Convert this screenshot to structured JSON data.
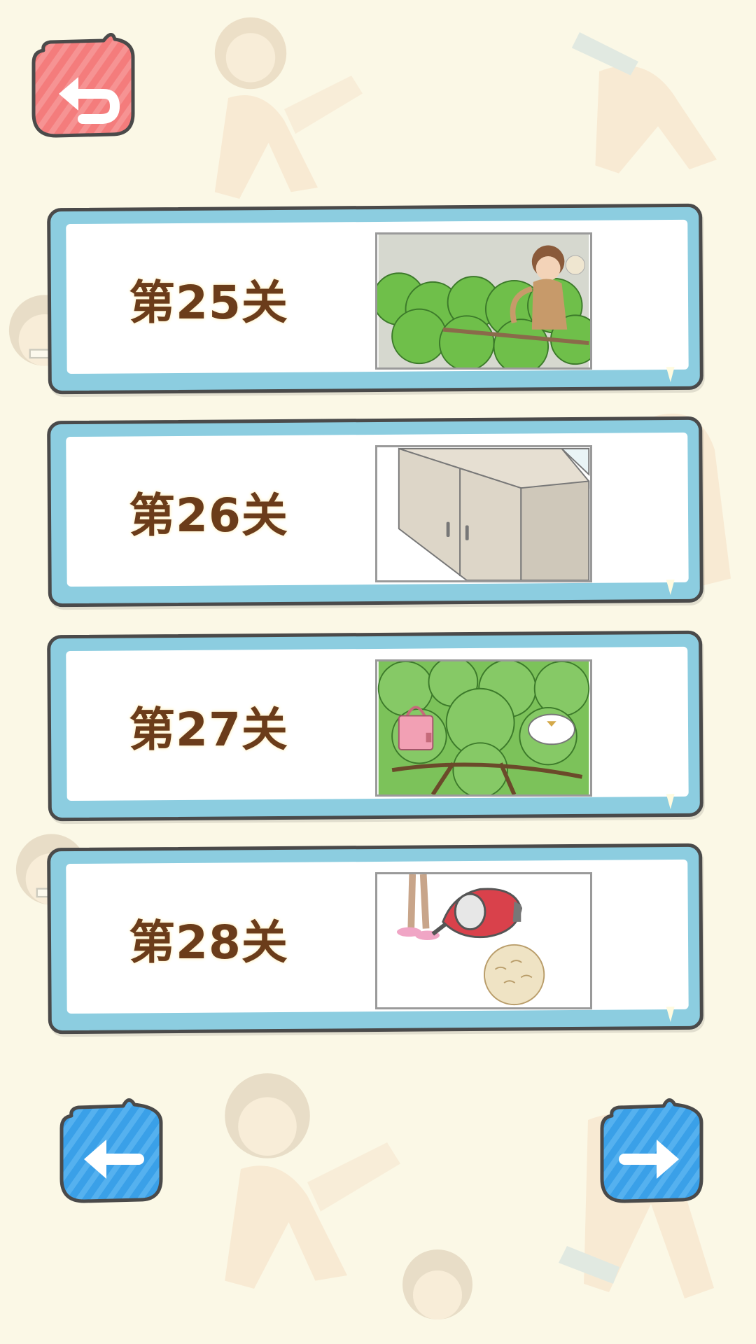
{
  "screen": "level-select",
  "colors": {
    "background": "#fbf8e6",
    "card_frame": "#8ccde0",
    "label_text": "#6b3c1a",
    "back_button": "#f47c7c",
    "nav_button": "#3aa0e8"
  },
  "buttons": {
    "back": {
      "icon": "undo-arrow-icon"
    },
    "prev": {
      "icon": "arrow-left-icon"
    },
    "next": {
      "icon": "arrow-right-icon"
    }
  },
  "levels": [
    {
      "label": "第25关",
      "thumbnail": "girl-monkey-in-tree"
    },
    {
      "label": "第26关",
      "thumbnail": "cabinet"
    },
    {
      "label": "第27关",
      "thumbnail": "bags-in-tree"
    },
    {
      "label": "第28关",
      "thumbnail": "vacuum-cleaner-hairball"
    }
  ]
}
